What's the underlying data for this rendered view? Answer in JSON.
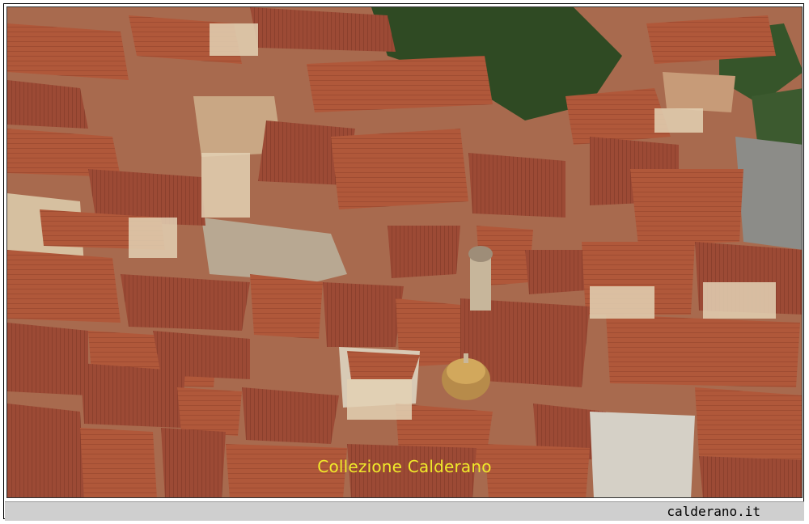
{
  "photo": {
    "description_icon": "aerial-town-photo",
    "watermark": "Collezione Calderano"
  },
  "footer": {
    "site": "calderano.it"
  },
  "colors": {
    "roof": "#b35a3a",
    "wall": "#d9c4a6",
    "foliage": "#2f4a23",
    "watermark": "#f0ea2a",
    "footer_bg": "#cfcfcf"
  }
}
